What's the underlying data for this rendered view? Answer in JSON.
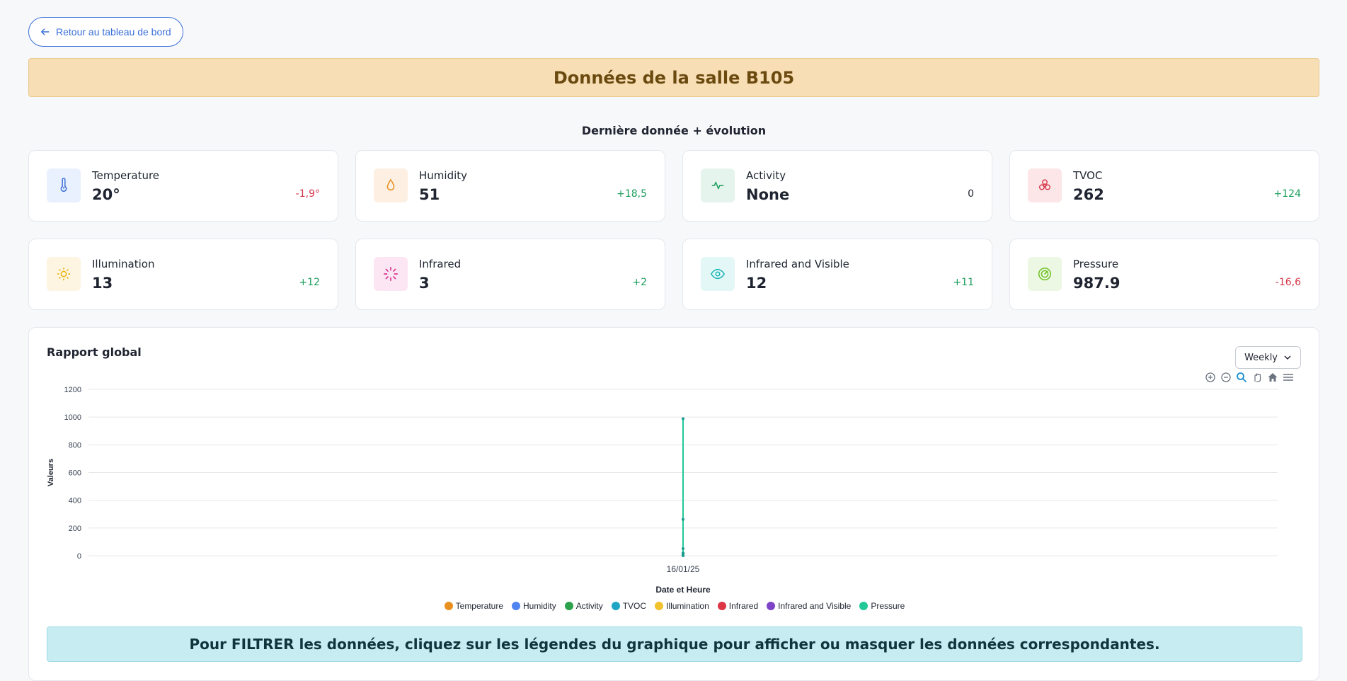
{
  "nav": {
    "back_label": "Retour au tableau de bord"
  },
  "banner": {
    "title": "Données de la salle B105"
  },
  "section": {
    "title": "Dernière donnée + évolution"
  },
  "cards": [
    {
      "label": "Temperature",
      "value": "20°",
      "delta": "-1,9°",
      "trend": "down",
      "icon": "thermometer-icon",
      "bg": "#e9f0fe",
      "fg": "#3b6fd8"
    },
    {
      "label": "Humidity",
      "value": "51",
      "delta": "+18,5",
      "trend": "up",
      "icon": "droplet-icon",
      "bg": "#fdf0e3",
      "fg": "#e8901f"
    },
    {
      "label": "Activity",
      "value": "None",
      "delta": "0",
      "trend": "neutral",
      "icon": "activity-icon",
      "bg": "#e6f4ee",
      "fg": "#1a9c5c"
    },
    {
      "label": "TVOC",
      "value": "262",
      "delta": "+124",
      "trend": "up",
      "icon": "biohazard-icon",
      "bg": "#fce6e8",
      "fg": "#d63648"
    },
    {
      "label": "Illumination",
      "value": "13",
      "delta": "+12",
      "trend": "up",
      "icon": "sun-icon",
      "bg": "#fdf4e1",
      "fg": "#eab308"
    },
    {
      "label": "Infrared",
      "value": "3",
      "delta": "+2",
      "trend": "up",
      "icon": "loader-icon",
      "bg": "#fce6f3",
      "fg": "#d6338f"
    },
    {
      "label": "Infrared and Visible",
      "value": "12",
      "delta": "+11",
      "trend": "up",
      "icon": "eye-icon",
      "bg": "#e3f7f7",
      "fg": "#16b3b3"
    },
    {
      "label": "Pressure",
      "value": "987.9",
      "delta": "-16,6",
      "trend": "down",
      "icon": "gauge-icon",
      "bg": "#ecf8e3",
      "fg": "#6cbf1f"
    }
  ],
  "colors": {
    "up": "#1a9c5c",
    "down": "#d63648",
    "neutral": "#1f2430"
  },
  "report": {
    "title": "Rapport global",
    "period": "Weekly",
    "filter_note": "Pour FILTRER les données, cliquez sur les légendes du graphique pour afficher ou masquer les données correspondantes."
  },
  "chart_data": {
    "type": "line",
    "title": "",
    "xlabel": "Date et Heure",
    "ylabel": "Valeurs",
    "ylim": [
      0,
      1200
    ],
    "yticks": [
      0,
      200,
      400,
      600,
      800,
      1000,
      1200
    ],
    "categories": [
      "16/01/25"
    ],
    "grid": true,
    "legend_position": "bottom",
    "series": [
      {
        "name": "Temperature",
        "color": "#e8901f",
        "values": [
          20
        ]
      },
      {
        "name": "Humidity",
        "color": "#4f83f0",
        "values": [
          51
        ]
      },
      {
        "name": "Activity",
        "color": "#2ca24c",
        "values": [
          0
        ]
      },
      {
        "name": "TVOC",
        "color": "#1fa5c4",
        "values": [
          262
        ]
      },
      {
        "name": "Illumination",
        "color": "#f2c12e",
        "values": [
          13
        ]
      },
      {
        "name": "Infrared",
        "color": "#dc3545",
        "values": [
          3
        ]
      },
      {
        "name": "Infrared and Visible",
        "color": "#7e44c8",
        "values": [
          12
        ]
      },
      {
        "name": "Pressure",
        "color": "#20c997",
        "values": [
          987.9
        ]
      }
    ]
  }
}
